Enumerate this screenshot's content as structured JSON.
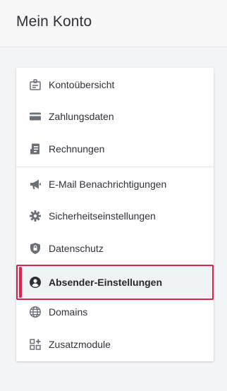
{
  "header": {
    "title": "Mein Konto"
  },
  "menu": {
    "items": [
      {
        "label": "Kontoübersicht",
        "icon": "id-badge-icon"
      },
      {
        "label": "Zahlungsdaten",
        "icon": "credit-card-icon"
      },
      {
        "label": "Rechnungen",
        "icon": "invoice-icon"
      },
      {
        "label": "E-Mail Benachrichtigungen",
        "icon": "megaphone-icon"
      },
      {
        "label": "Sicherheitseinstellungen",
        "icon": "gear-icon"
      },
      {
        "label": "Datenschutz",
        "icon": "shield-lock-icon"
      },
      {
        "label": "Absender-Einstellungen",
        "icon": "account-circle-icon",
        "active": true
      },
      {
        "label": "Domains",
        "icon": "globe-icon"
      },
      {
        "label": "Zusatzmodule",
        "icon": "apps-plus-icon"
      }
    ]
  },
  "colors": {
    "accent": "#e0234e",
    "icon": "#6b6f76",
    "active_background": "#f1f2f4"
  }
}
